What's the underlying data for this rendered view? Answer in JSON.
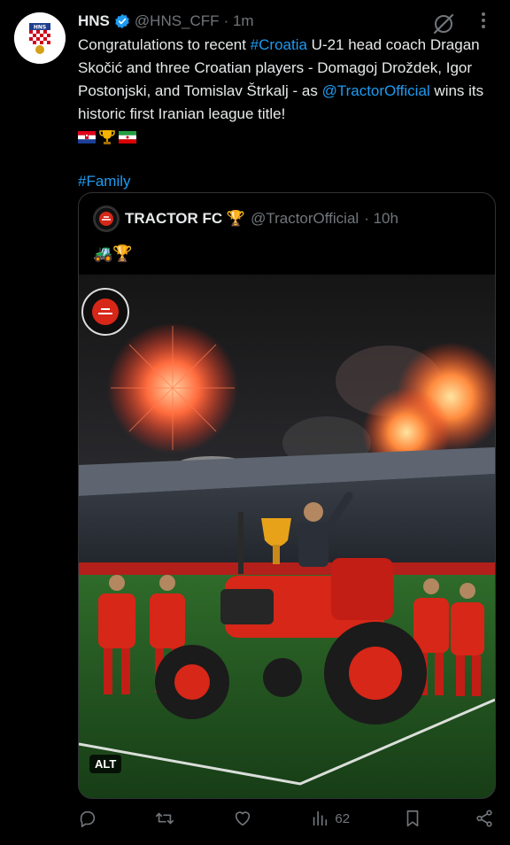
{
  "tweet": {
    "name": "HNS",
    "handle": "@HNS_CFF",
    "time": "· 1m",
    "text_prefix": "Congratulations to recent ",
    "hashtag1": "#Croatia",
    "text_mid": " U-21 head coach Dragan Skočić and three Croatian players - Domagoj Droždek, Igor Postonjski, and Tomislav Štrkalj - as ",
    "mention": "@TractorOfficial",
    "text_suffix": " wins its historic first Iranian league title!",
    "hashtag2": "#Family",
    "emojis": [
      "croatia-flag",
      "trophy",
      "iran-flag"
    ]
  },
  "quote": {
    "name": "TRACTOR FC 🏆",
    "handle": "@TractorOfficial",
    "time": "· 10h",
    "emojis": "🚜🏆",
    "alt_label": "ALT"
  },
  "actions": {
    "reply": "",
    "retweet": "",
    "like": "",
    "views": "62",
    "bookmark": "",
    "share": ""
  },
  "colors": {
    "background": "#000000",
    "link": "#1d9bf0",
    "muted": "#71767b",
    "text": "#e7e9ea"
  }
}
